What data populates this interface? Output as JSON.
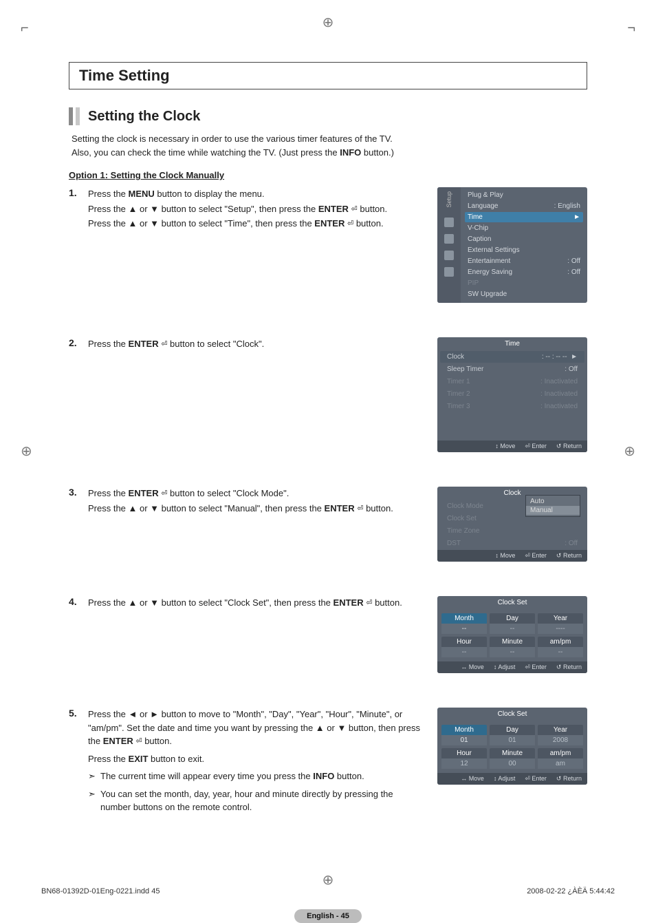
{
  "titles": {
    "main": "Time Setting",
    "section": "Setting the Clock"
  },
  "intro": {
    "line1": "Setting the clock is necessary in order to use the various timer features of the TV.",
    "line2_a": "Also, you can check the time while watching the TV. (Just press the ",
    "line2_b": "INFO",
    "line2_c": " button.)"
  },
  "option1": "Option 1: Setting the Clock Manually",
  "steps": {
    "n1": "1.",
    "s1a": "Press the ",
    "s1b": "MENU",
    "s1c": " button to display the menu.",
    "s1d": "Press the ▲ or ▼ button to select \"Setup\", then press the ",
    "s1e": "ENTER",
    "s1f": " button.",
    "s1g": "Press the ▲ or ▼ button to select \"Time\", then press the ",
    "s1h": "ENTER",
    "s1i": " button.",
    "n2": "2.",
    "s2a": "Press the ",
    "s2b": "ENTER",
    "s2c": " button to select \"Clock\".",
    "n3": "3.",
    "s3a": "Press the ",
    "s3b": "ENTER",
    "s3c": " button to select \"Clock Mode\".",
    "s3d": "Press the ▲ or ▼ button to select \"Manual\", then press the ",
    "s3e": "ENTER",
    "s3f": " button.",
    "n4": "4.",
    "s4a": "Press the ▲ or ▼ button to select \"Clock Set\", then press the ",
    "s4b": "ENTER",
    "s4c": " button.",
    "n5": "5.",
    "s5a": "Press the ◄ or ► button to move to \"Month\", \"Day\", \"Year\", \"Hour\", \"Minute\", or \"am/pm\". Set the date and time you want by pressing the ▲ or ▼ button, then press the ",
    "s5b": "ENTER",
    "s5c": " button.",
    "s5d": "Press the ",
    "s5e": "EXIT",
    "s5f": " button to exit.",
    "tip1a": "The current time will appear every time you press the ",
    "tip1b": "INFO",
    "tip1c": " button.",
    "tip2": "You can set the month, day, year, hour and minute directly by pressing the number buttons on the remote control."
  },
  "icons": {
    "enter": "⏎",
    "tip": "➣"
  },
  "osd": {
    "setup": {
      "side": "Setup",
      "plug": "Plug & Play",
      "lang": "Language",
      "lang_v": ": English",
      "time": "Time",
      "vchip": "V-Chip",
      "caption": "Caption",
      "ext": "External Settings",
      "ent": "Entertainment",
      "ent_v": ": Off",
      "es": "Energy Saving",
      "es_v": ": Off",
      "pip": "PIP",
      "sw": "SW Upgrade",
      "arrow": "►"
    },
    "time": {
      "title": "Time",
      "clock": "Clock",
      "clock_v": ": -- : -- --",
      "sleep": "Sleep Timer",
      "sleep_v": ": Off",
      "t1": "Timer 1",
      "t1v": ": Inactivated",
      "t2": "Timer 2",
      "t2v": ": Inactivated",
      "t3": "Timer 3",
      "t3v": ": Inactivated",
      "arrow": "►"
    },
    "clock": {
      "title": "Clock",
      "mode": "Clock Mode",
      "auto": "Auto",
      "manual": "Manual",
      "set": "Clock Set",
      "tz": "Time Zone",
      "dst": "DST",
      "dst_v": ": Off"
    },
    "cs1": {
      "title": "Clock Set",
      "month": "Month",
      "month_v": "--",
      "day": "Day",
      "day_v": "--",
      "year": "Year",
      "year_v": "----",
      "hour": "Hour",
      "hour_v": "--",
      "minute": "Minute",
      "minute_v": "--",
      "ampm": "am/pm",
      "ampm_v": "--"
    },
    "cs2": {
      "title": "Clock Set",
      "month": "Month",
      "month_v": "01",
      "day": "Day",
      "day_v": "01",
      "year": "Year",
      "year_v": "2008",
      "hour": "Hour",
      "hour_v": "12",
      "minute": "Minute",
      "minute_v": "00",
      "ampm": "am/pm",
      "ampm_v": "am"
    },
    "footer": {
      "move": "Move",
      "enter": "Enter",
      "return": "Return",
      "adjust": "Adjust"
    },
    "sym": {
      "ud": "↕",
      "lr": "↔",
      "enter": "⏎",
      "ret": "↺"
    }
  },
  "page_label": "English - 45",
  "imprint": {
    "file": "BN68-01392D-01Eng-0221.indd   45",
    "ts": "2008-02-22   ¿ÀÈÄ 5:44:42"
  }
}
